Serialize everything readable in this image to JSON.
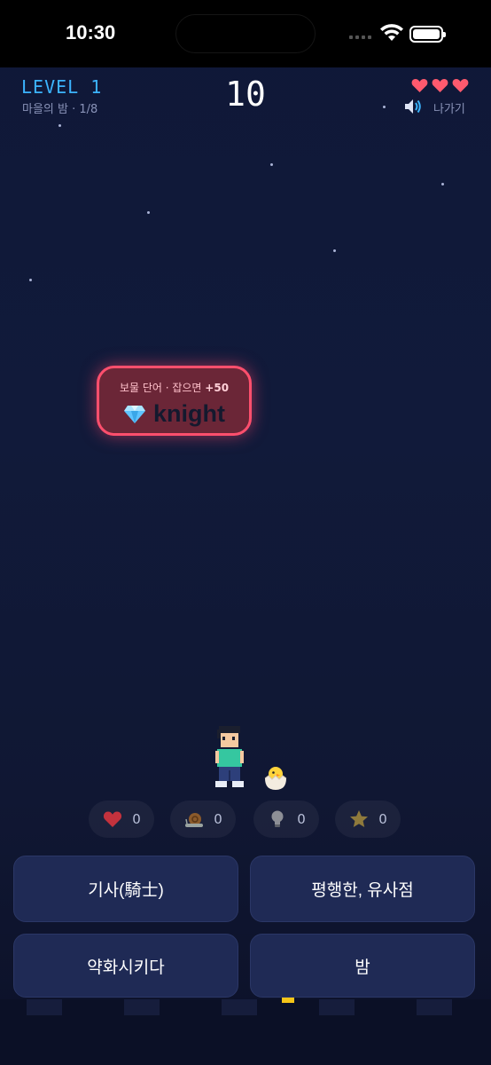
{
  "status_bar": {
    "time": "10:30"
  },
  "header": {
    "level_label": "LEVEL 1",
    "stage_label": "마을의 밤 · 1/8",
    "score": "10",
    "lives": 3,
    "exit_label": "나가기"
  },
  "treasure": {
    "hint_prefix": "보물 단어 · 잡으면 ",
    "bonus": "+50",
    "word": "knight"
  },
  "items": [
    {
      "icon": "heart-icon",
      "count": "0"
    },
    {
      "icon": "snail-icon",
      "count": "0"
    },
    {
      "icon": "lightbulb-icon",
      "count": "0"
    },
    {
      "icon": "star-icon",
      "count": "0"
    }
  ],
  "answers": [
    {
      "label": "기사(騎士)"
    },
    {
      "label": "평행한, 유사점"
    },
    {
      "label": "약화시키다"
    },
    {
      "label": "밤"
    }
  ],
  "colors": {
    "accent_level": "#3cb4ff",
    "card_border": "#ff4f6d",
    "heart": "#ff5a6e",
    "answer_bg": "#1f2a55"
  }
}
